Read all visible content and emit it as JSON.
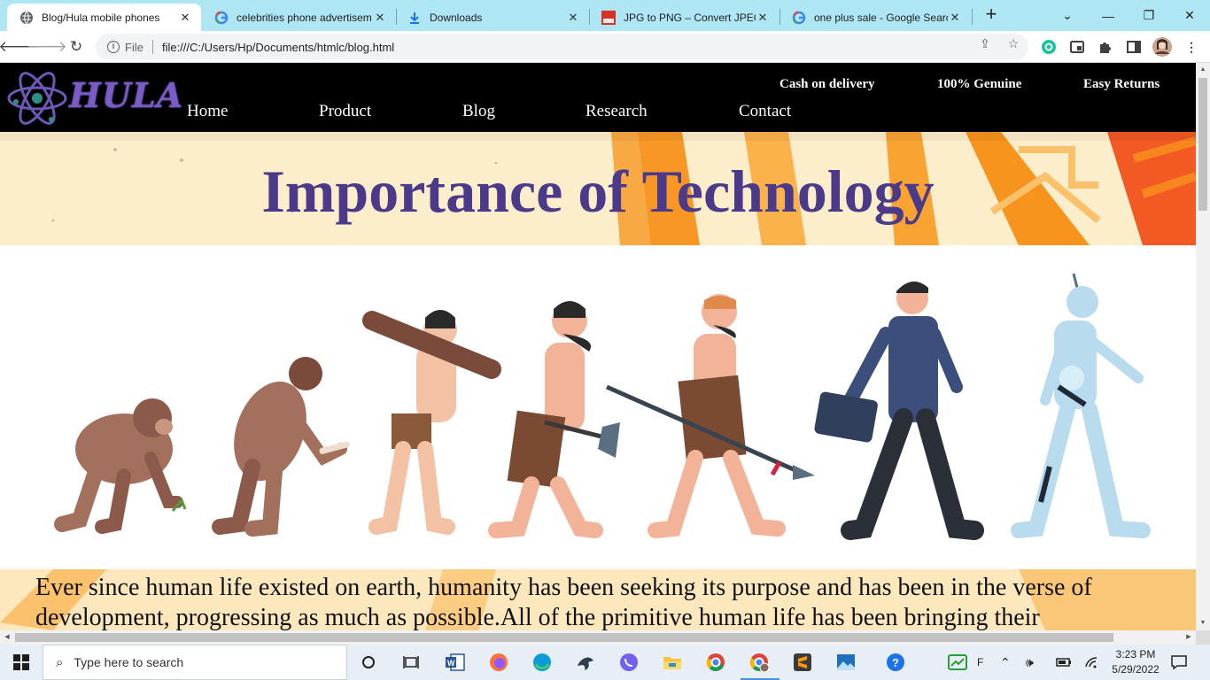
{
  "browser": {
    "tabs": [
      {
        "title": "Blog/Hula mobile phones",
        "favicon": "globe-icon",
        "active": true
      },
      {
        "title": "celebrities phone advertisem",
        "favicon": "google-icon",
        "active": false
      },
      {
        "title": "Downloads",
        "favicon": "download-icon",
        "active": false
      },
      {
        "title": "JPG to PNG – Convert JPEG t",
        "favicon": "jpgpng-icon",
        "active": false
      },
      {
        "title": "one plus sale - Google Searc",
        "favicon": "google-icon",
        "active": false
      }
    ],
    "address": {
      "scheme_label": "File",
      "url": "file:///C:/Users/Hp/Documents/htmlc/blog.html"
    }
  },
  "site": {
    "logo_text": "HULA",
    "features": [
      "Cash on delivery",
      "100% Genuine",
      "Easy Returns"
    ],
    "nav": [
      "Home",
      "Product",
      "Blog",
      "Research",
      "Contact"
    ],
    "banner_heading": "Importance of Technology",
    "paragraph": "Ever since human life existed on earth, humanity has been seeking its purpose and has been in the verse of development, progressing as much as possible.All of the primitive human life has been bringing their"
  },
  "taskbar": {
    "search_placeholder": "Type here to search",
    "tray_letter": "F",
    "time": "3:23 PM",
    "date": "5/29/2022"
  },
  "colors": {
    "tabbar": "#aee6f4",
    "heading": "#4b3a8a",
    "header_bg": "#000000",
    "banner_bg": "#fdeecb"
  }
}
